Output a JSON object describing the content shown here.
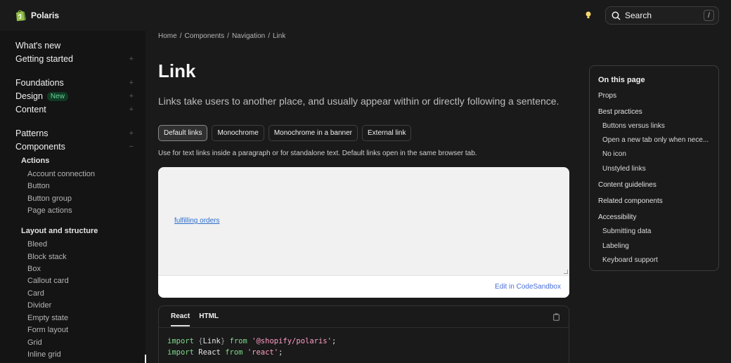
{
  "app": {
    "name": "Polaris"
  },
  "search": {
    "label": "Search",
    "shortcut": "/"
  },
  "sidebar": {
    "top": [
      {
        "label": "What's new",
        "expandable": false
      },
      {
        "label": "Getting started",
        "expandable": true
      },
      {
        "label": "Foundations",
        "expandable": true
      },
      {
        "label": "Design",
        "badge": "New",
        "expandable": true
      },
      {
        "label": "Content",
        "expandable": true
      },
      {
        "label": "Patterns",
        "expandable": true
      },
      {
        "label": "Components",
        "expandable": true,
        "expanded": true
      }
    ],
    "groups": [
      {
        "label": "Actions",
        "items": [
          "Account connection",
          "Button",
          "Button group",
          "Page actions"
        ]
      },
      {
        "label": "Layout and structure",
        "items": [
          "Bleed",
          "Block stack",
          "Box",
          "Callout card",
          "Card",
          "Divider",
          "Empty state",
          "Form layout",
          "Grid",
          "Inline grid"
        ]
      }
    ],
    "expand_glyph": "+",
    "collapse_glyph": "−"
  },
  "breadcrumb": [
    "Home",
    "Components",
    "Navigation",
    "Link"
  ],
  "breadcrumb_sep": "/",
  "page": {
    "title": "Link",
    "lead": "Links take users to another place, and usually appear within or directly following a sentence.",
    "tabs": [
      "Default links",
      "Monochrome",
      "Monochrome in a banner",
      "External link"
    ],
    "active_tab": 0,
    "description": "Use for text links inside a paragraph or for standalone text. Default links open in the same browser tab.",
    "preview_link": "fulfilling orders",
    "sandbox_label": "Edit in CodeSandbox"
  },
  "code": {
    "tabs": [
      "React",
      "HTML"
    ],
    "active_tab": 0,
    "lines": [
      {
        "kw": "import",
        "pre": " ",
        "brace_open": "{",
        "name": "Link",
        "brace_close": "}",
        "from": " from ",
        "str": "'@shopify/polaris'",
        "end": ";"
      },
      {
        "kw": "import",
        "pre": " ",
        "name": "React",
        "from": " from ",
        "str": "'react'",
        "end": ";"
      }
    ]
  },
  "toc": {
    "title": "On this page",
    "items": [
      {
        "label": "Props",
        "sub": false
      },
      {
        "label": "Best practices",
        "sub": false
      },
      {
        "label": "Buttons versus links",
        "sub": true
      },
      {
        "label": "Open a new tab only when nece...",
        "sub": true
      },
      {
        "label": "No icon",
        "sub": true
      },
      {
        "label": "Unstyled links",
        "sub": true
      },
      {
        "label": "Content guidelines",
        "sub": false
      },
      {
        "label": "Related components",
        "sub": false
      },
      {
        "label": "Accessibility",
        "sub": false
      },
      {
        "label": "Submitting data",
        "sub": true
      },
      {
        "label": "Labeling",
        "sub": true
      },
      {
        "label": "Keyboard support",
        "sub": true
      }
    ]
  },
  "colors": {
    "accent_link": "#2c6ecb",
    "badge_bg": "#0f3b25",
    "badge_fg": "#6ad29a"
  },
  "icons": {
    "logo": "shopify-bag-icon",
    "theme": "lightbulb-icon",
    "search": "search-icon",
    "copy": "clipboard-icon"
  }
}
